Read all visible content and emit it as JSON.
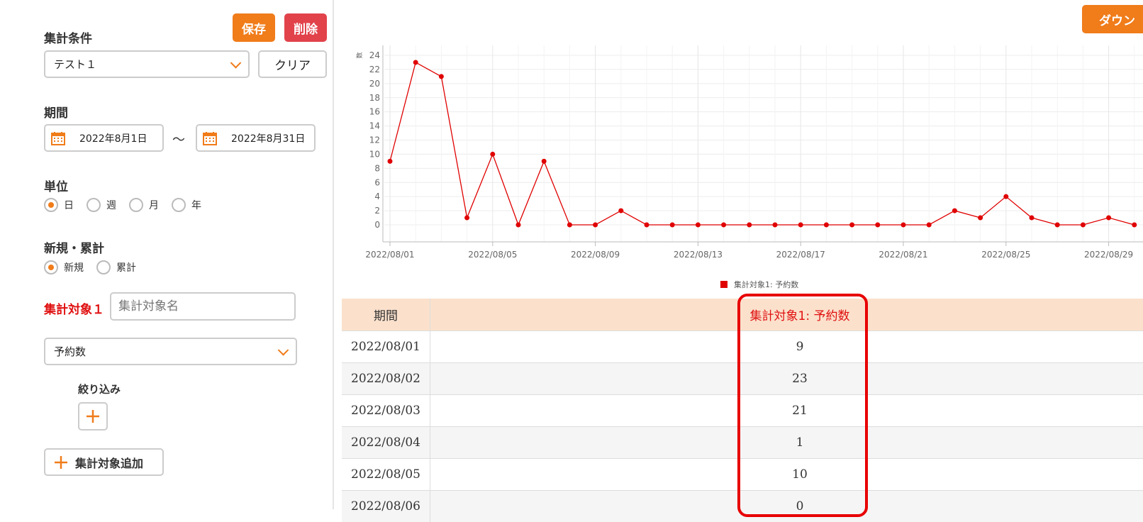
{
  "header": {
    "save_label": "保存",
    "delete_label": "削除",
    "download_label": "ダウン"
  },
  "sidebar": {
    "conditions_label": "集計条件",
    "conditions_value": "テスト１",
    "clear_label": "クリア",
    "period_label": "期間",
    "date_from": "2022年8月1日",
    "date_sep": "〜",
    "date_to": "2022年8月31日",
    "unit_label": "単位",
    "unit_options": [
      "日",
      "週",
      "月",
      "年"
    ],
    "new_cum_label": "新規・累計",
    "new_cum_options": [
      "新規",
      "累計"
    ],
    "target_label": "集計対象１",
    "target_placeholder": "集計対象名",
    "metric_value": "予約数",
    "filter_label": "絞り込み",
    "add_target_label": "集計対象追加"
  },
  "colors": {
    "accent": "#f07c1a",
    "danger": "#e2434b",
    "series": "#e00000",
    "highlight": "#e80000"
  },
  "chart_data": {
    "type": "line",
    "ylabel": "数",
    "ylim": [
      0,
      24
    ],
    "yticks": [
      0,
      2,
      4,
      6,
      8,
      10,
      12,
      14,
      16,
      18,
      20,
      22,
      24
    ],
    "x_tick_labels": [
      "2022/08/01",
      "2022/08/05",
      "2022/08/09",
      "2022/08/13",
      "2022/08/17",
      "2022/08/21",
      "2022/08/25",
      "2022/08/29"
    ],
    "legend": "集計対象1: 予約数",
    "series": [
      {
        "name": "集計対象1: 予約数",
        "x": [
          "2022/08/01",
          "2022/08/02",
          "2022/08/03",
          "2022/08/04",
          "2022/08/05",
          "2022/08/06",
          "2022/08/07",
          "2022/08/08",
          "2022/08/09",
          "2022/08/10",
          "2022/08/11",
          "2022/08/12",
          "2022/08/13",
          "2022/08/14",
          "2022/08/15",
          "2022/08/16",
          "2022/08/17",
          "2022/08/18",
          "2022/08/19",
          "2022/08/20",
          "2022/08/21",
          "2022/08/22",
          "2022/08/23",
          "2022/08/24",
          "2022/08/25",
          "2022/08/26",
          "2022/08/27",
          "2022/08/28",
          "2022/08/29",
          "2022/08/30"
        ],
        "values": [
          9,
          23,
          21,
          1,
          10,
          0,
          9,
          0,
          0,
          2,
          0,
          0,
          0,
          0,
          0,
          0,
          0,
          0,
          0,
          0,
          0,
          0,
          2,
          1,
          4,
          1,
          0,
          0,
          1,
          0
        ]
      }
    ]
  },
  "table": {
    "headers": [
      "期間",
      "",
      "集計対象1: 予約数"
    ],
    "rows": [
      {
        "period": "2022/08/01",
        "value": "9"
      },
      {
        "period": "2022/08/02",
        "value": "23"
      },
      {
        "period": "2022/08/03",
        "value": "21"
      },
      {
        "period": "2022/08/04",
        "value": "1"
      },
      {
        "period": "2022/08/05",
        "value": "10"
      },
      {
        "period": "2022/08/06",
        "value": "0"
      }
    ]
  }
}
